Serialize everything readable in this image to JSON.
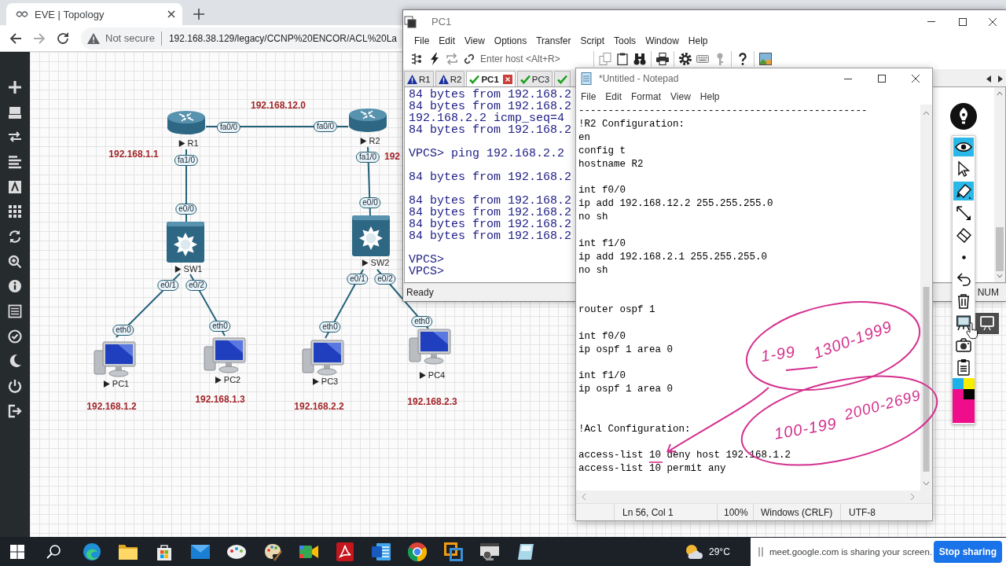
{
  "browser": {
    "tab": {
      "title": "EVE | Topology"
    },
    "address": {
      "security": "Not secure",
      "url": "192.168.38.129/legacy/CCNP%20ENCOR/ACL%20La"
    }
  },
  "topology": {
    "nodes": [
      {
        "name": "R1",
        "kind": "router"
      },
      {
        "name": "R2",
        "kind": "router"
      },
      {
        "name": "SW1",
        "kind": "switch"
      },
      {
        "name": "SW2",
        "kind": "switch"
      },
      {
        "name": "PC1",
        "kind": "pc"
      },
      {
        "name": "PC2",
        "kind": "pc"
      },
      {
        "name": "PC3",
        "kind": "pc"
      },
      {
        "name": "PC4",
        "kind": "pc"
      }
    ],
    "links": [
      {
        "ports": [
          "fa0/0",
          "fa0/0"
        ]
      },
      {
        "ports": [
          "fa1/0",
          "e0/0"
        ]
      },
      {
        "ports": [
          "fa1/0",
          "e0/0"
        ]
      },
      {
        "ports": [
          "e0/1",
          "eth0"
        ]
      },
      {
        "ports": [
          "e0/2",
          "eth0"
        ]
      },
      {
        "ports": [
          "e0/1",
          "eth0"
        ]
      },
      {
        "ports": [
          "e0/2",
          "eth0"
        ]
      }
    ],
    "address_labels": [
      "192.168.12.0",
      "192.168.1.1",
      "192",
      "192.168.1.2",
      "192.168.1.3",
      "192.168.2.2",
      "192.168.2.3"
    ]
  },
  "terminal_window": {
    "title": "PC1",
    "menu": [
      "File",
      "Edit",
      "View",
      "Options",
      "Transfer",
      "Script",
      "Tools",
      "Window",
      "Help"
    ],
    "host_field": {
      "placeholder": "Enter host <Alt+R>"
    },
    "tabs": [
      {
        "label": "R1",
        "kind": "warning",
        "selected": false
      },
      {
        "label": "R2",
        "kind": "warning",
        "selected": false
      },
      {
        "label": "PC1",
        "kind": "ok",
        "selected": true
      },
      {
        "label": "PC3",
        "kind": "ok",
        "selected": false
      },
      {
        "kind": "ok",
        "selected": false
      }
    ],
    "output": "84 bytes from 192.168.2\n84 bytes from 192.168.2\n192.168.2.2 icmp_seq=4\n84 bytes from 192.168.2\n\nVPCS> ping 192.168.2.2\n\n84 bytes from 192.168.2\n\n84 bytes from 192.168.2\n84 bytes from 192.168.2\n84 bytes from 192.168.2\n84 bytes from 192.168.2\n\nVPCS>\nVPCS>",
    "status_bar": {
      "message": "Ready",
      "indicator": "NUM"
    }
  },
  "notepad": {
    "title": "*Untitled - Notepad",
    "menu": [
      "File",
      "Edit",
      "Format",
      "View",
      "Help"
    ],
    "content": "-------------------------------------------------\n!R2 Configuration:\nen\nconfig t\nhostname R2\n\nint f0/0\nip add 192.168.12.2 255.255.255.0\nno sh\n\nint f1/0\nip add 192.168.2.1 255.255.255.0\nno sh\n\n\nrouter ospf 1\n\nint f0/0\nip ospf 1 area 0\n\nint f1/0\nip ospf 1 area 0\n\n\n!Acl Configuration:\n\naccess-list 10 deny host 192.168.1.2\naccess-list 10 permit any",
    "status_bar": [
      "Ln 56, Col 1",
      "100%",
      "Windows (CRLF)",
      "UTF-8"
    ]
  },
  "ink": {
    "notes": [
      "1-99",
      "1300-1999",
      "100-199",
      "2000-2699"
    ]
  },
  "annotation_toolbar": {
    "tools": [
      {
        "kind": "eye",
        "selected": true
      },
      {
        "kind": "pointer",
        "selected": false
      },
      {
        "kind": "highlighter",
        "selected": true
      },
      {
        "kind": "arrow",
        "selected": false
      },
      {
        "kind": "eraser",
        "selected": false
      },
      {
        "kind": "dot",
        "selected": false
      },
      {
        "kind": "undo",
        "selected": false
      },
      {
        "kind": "trash",
        "selected": false
      },
      {
        "kind": "board",
        "selected": false
      },
      {
        "kind": "camera",
        "selected": false
      },
      {
        "kind": "clipboard",
        "selected": false
      }
    ],
    "palette": [
      {
        "color": "#1bb1e9"
      },
      {
        "color": "#f8ec00"
      },
      {
        "color": "#000000"
      },
      {
        "color": "#ef0d8c"
      }
    ]
  },
  "taskbar": {
    "temperature": "29°C"
  },
  "share_banner": {
    "message": "meet.google.com is sharing your screen.",
    "button": "Stop sharing"
  }
}
